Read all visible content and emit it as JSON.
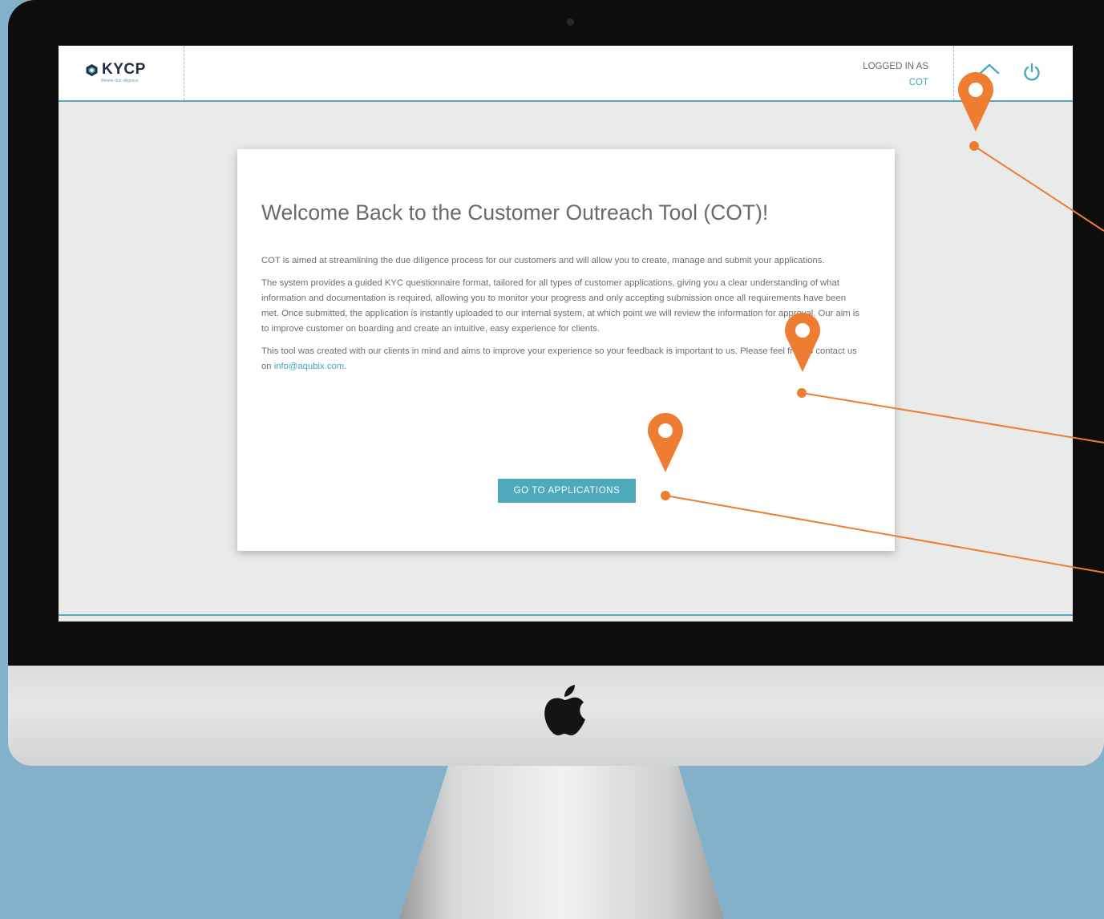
{
  "app": {
    "logo_text": "KYCP",
    "logo_tagline": "lifetime due diligence"
  },
  "header": {
    "logged_in_label": "LOGGED IN AS",
    "logged_in_user": "COT",
    "home_icon": "home-icon",
    "power_icon": "power-icon"
  },
  "welcome": {
    "title": "Welcome Back to the Customer Outreach Tool (COT)!",
    "paragraph1": "COT is aimed at streamlining the due diligence process for our customers and will allow you to create, manage and submit your applications.",
    "paragraph2": "The system provides a guided KYC questionnaire format, tailored for all types of customer applications, giving you a clear understanding of what information and documentation is required, allowing you to monitor your progress and only accepting submission once all requirements have been met. Once submitted, the application is instantly uploaded to our internal system, at which point we will review the information for approval. Our aim is to improve customer on boarding and create an intuitive, easy experience for clients.",
    "paragraph3_prefix": "This tool was created with our clients in mind and aims to improve your experience so your feedback is important to us. Please feel free to contact us on ",
    "contact_email": "info@aqubix.com",
    "paragraph3_suffix": ".",
    "cta_label": "GO TO APPLICATIONS"
  },
  "colors": {
    "accent": "#4daabc",
    "annotation": "#ee7d31",
    "background": "#84b1ca"
  }
}
